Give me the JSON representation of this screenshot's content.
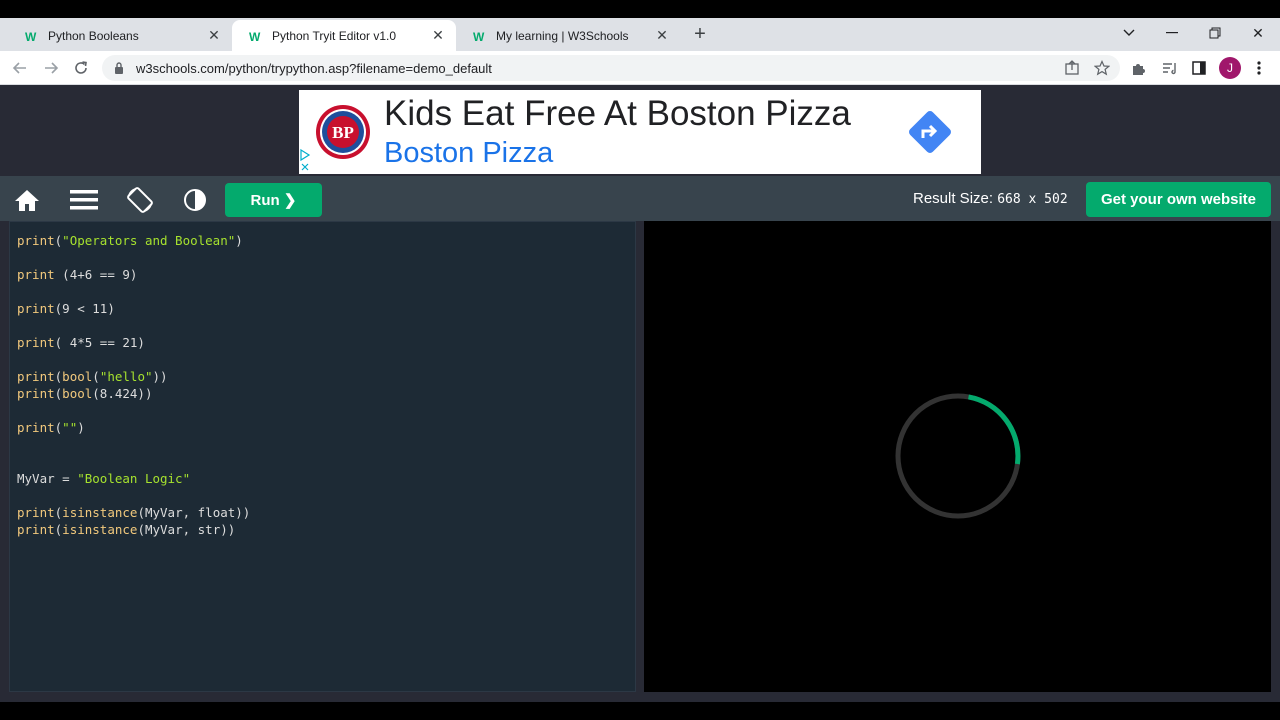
{
  "browser": {
    "tabs": [
      {
        "title": "Python Booleans",
        "active": false
      },
      {
        "title": "Python Tryit Editor v1.0",
        "active": true
      },
      {
        "title": "My learning | W3Schools",
        "active": false
      }
    ],
    "url": "w3schools.com/python/trypython.asp?filename=demo_default",
    "profile_initial": "J"
  },
  "ad": {
    "headline": "Kids Eat Free At Boston Pizza",
    "brand": "Boston Pizza"
  },
  "editor": {
    "run_label": "Run ❯",
    "result_size_label": "Result Size:",
    "result_size_value": "668 x 502",
    "get_website_label": "Get your own website",
    "code_lines": [
      "print(\"Operators and Boolean\")",
      "",
      "print (4+6 == 9)",
      "",
      "print(9 < 11)",
      "",
      "print( 4*5 == 21)",
      "",
      "print(bool(\"hello\"))",
      "print(bool(8.424))",
      "",
      "print(\"\")",
      "",
      "",
      "MyVar = \"Boolean Logic\"",
      "",
      "print(isinstance(MyVar, float))",
      "print(isinstance(MyVar, str))"
    ]
  },
  "colors": {
    "accent": "#04aa6d",
    "page_bg": "#282a35",
    "toolbar_bg": "#38444d",
    "code_bg": "#1d2a35"
  }
}
